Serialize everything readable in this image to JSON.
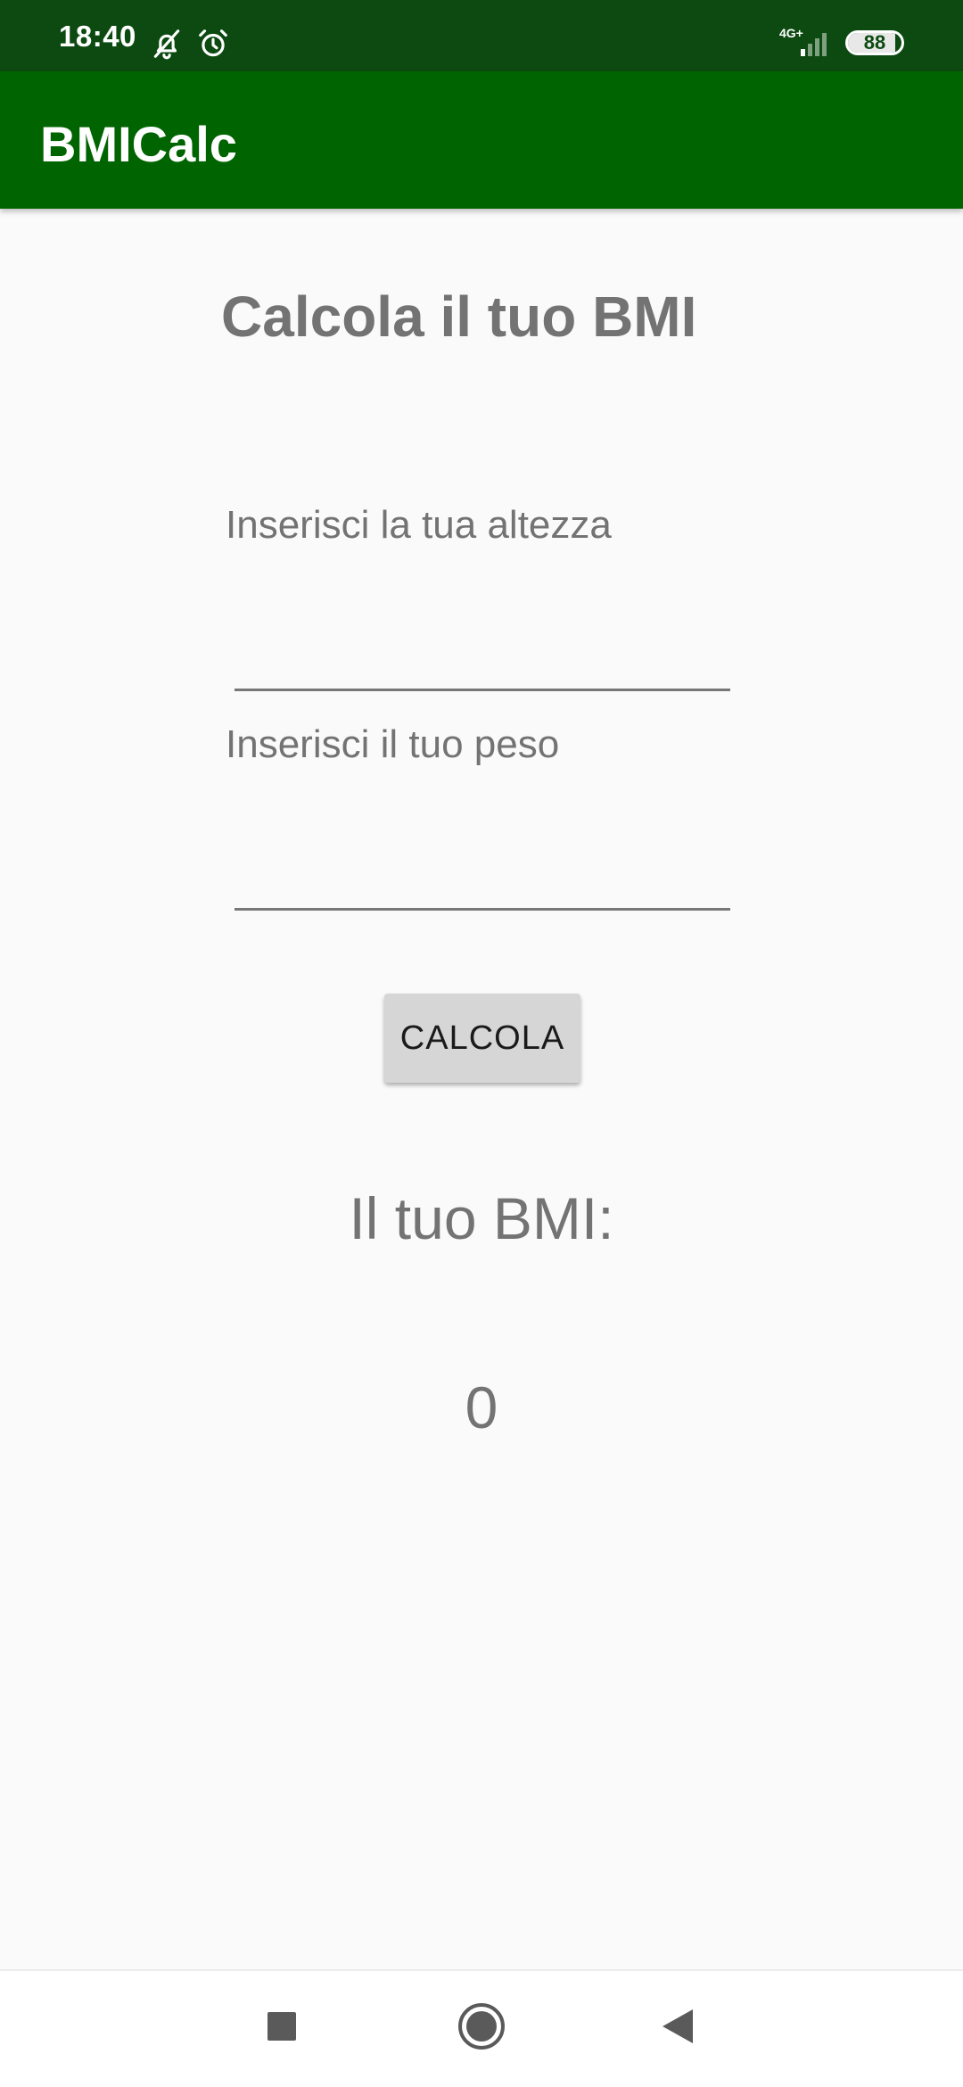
{
  "status_bar": {
    "time": "18:40",
    "network_label": "4G+",
    "battery_level": 88,
    "battery_text": "88",
    "icons": [
      "mute-icon",
      "alarm-icon",
      "signal-icon",
      "battery-icon"
    ]
  },
  "app_bar": {
    "title": "BMICalc"
  },
  "main": {
    "heading": "Calcola il tuo BMI",
    "height_label": "Inserisci la tua altezza",
    "height_value": "",
    "weight_label": "Inserisci il tuo peso",
    "weight_value": "",
    "calc_button_label": "CALCOLA",
    "result_label": "Il tuo BMI:",
    "result_value": "0"
  },
  "nav_bar": {
    "icons": [
      "recents-icon",
      "home-icon",
      "back-icon"
    ]
  },
  "colors": {
    "status_bar": "#0c4a11",
    "app_bar": "#006400",
    "background": "#fafafa",
    "text_gray": "#737373",
    "button": "#d6d6d6"
  }
}
